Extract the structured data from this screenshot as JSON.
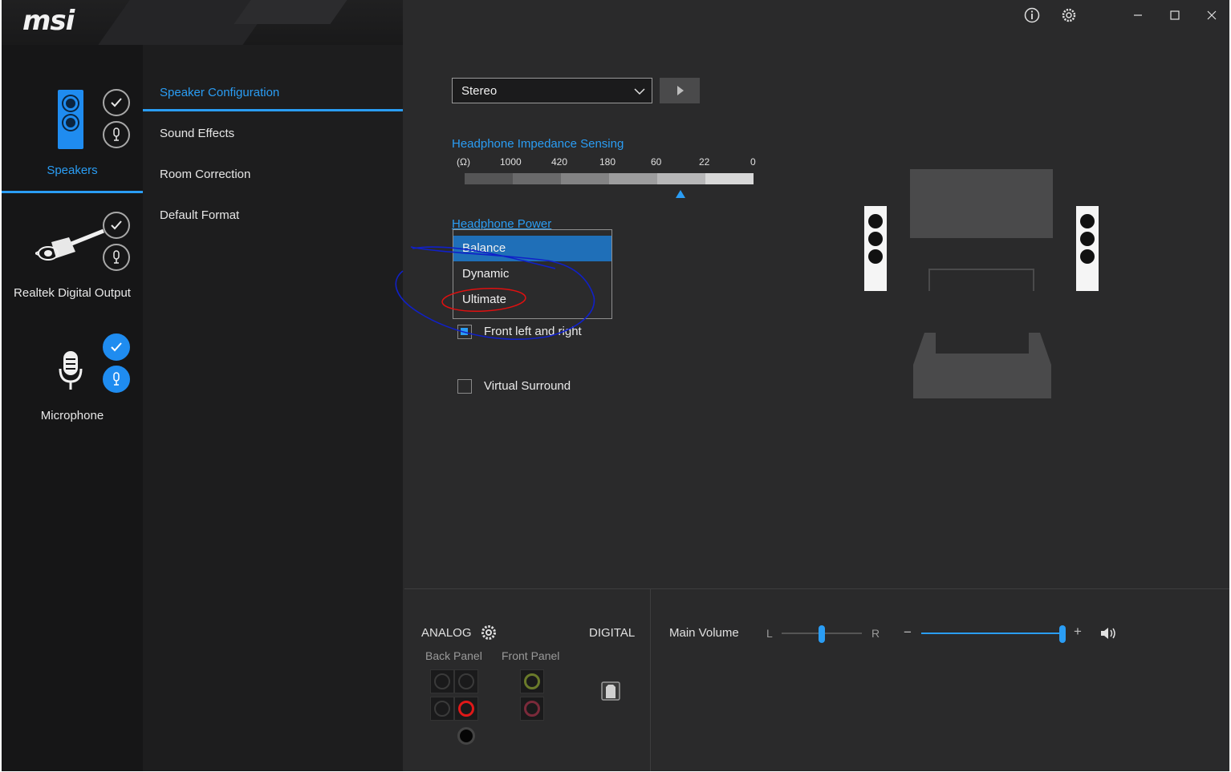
{
  "app": {
    "logo": "msi",
    "window_controls": [
      "info-icon",
      "gear-icon",
      "minimize-icon",
      "maximize-icon",
      "close-icon"
    ]
  },
  "devices": [
    {
      "label": "Speakers",
      "icon": "speaker-icon",
      "active": true
    },
    {
      "label": "Realtek Digital Output",
      "icon": "rca-plug-icon",
      "active": false
    },
    {
      "label": "Microphone",
      "icon": "microphone-icon",
      "active": false
    }
  ],
  "menu": {
    "items": [
      "Speaker Configuration",
      "Sound Effects",
      "Room Correction",
      "Default Format"
    ],
    "active_index": 0
  },
  "speaker_config": {
    "select_value": "Stereo",
    "impedance": {
      "title": "Headphone Impedance Sensing",
      "unit": "(Ω)",
      "ticks": [
        "1000",
        "420",
        "180",
        "60",
        "22",
        "0"
      ]
    },
    "power": {
      "title": "Headphone Power",
      "options": [
        "Balance",
        "Dynamic",
        "Ultimate"
      ],
      "selected": "Balance"
    },
    "checkboxes": [
      {
        "label": "Front left and right",
        "checked": true
      },
      {
        "label": "Virtual Surround",
        "checked": false
      }
    ]
  },
  "bottom": {
    "analog_label": "ANALOG",
    "digital_label": "DIGITAL",
    "back_panel_label": "Back Panel",
    "front_panel_label": "Front Panel",
    "main_volume_label": "Main Volume",
    "balance_left": "L",
    "balance_right": "R",
    "volume_minus": "−",
    "volume_plus": "+",
    "balance_position": 0.5,
    "volume_level": 0.98
  },
  "colors": {
    "accent": "#2a9df4",
    "selected_option": "#1f6fb8",
    "annotation_blue": "#1020c8",
    "annotation_red": "#e01010"
  }
}
